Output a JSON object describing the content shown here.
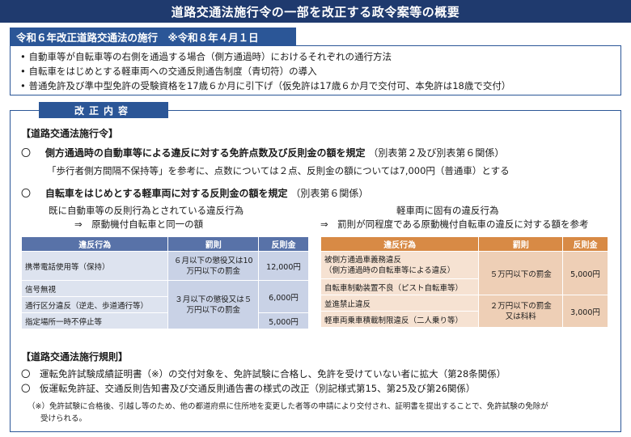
{
  "title": "道路交通法施行令の一部を改正する政令案等の概要",
  "section1": {
    "header": "令和６年改正道路交通法の施行　※令和８年４月１日",
    "bullets": [
      "自動車等が自転車等の右側を通過する場合（側方通過時）におけるそれぞれの通行方法",
      "自転車をはじめとする軽車両への交通反則通告制度（青切符）の導入",
      "普通免許及び準中型免許の受験資格を17歳６か月に引下げ（仮免許は17歳６か月で交付可、本免許は18歳で交付）"
    ]
  },
  "section2": {
    "header": "改正内容",
    "order": {
      "heading": "【道路交通法施行令】",
      "item1": {
        "mark": "〇",
        "bold": "側方通過時の自動車等による違反に対する免許点数及び反則金の額を規定",
        "ref": "（別表第２及び別表第６関係）",
        "detail": "「歩行者側方間隔不保持等」を参考に、点数については２点、反則金の額については7,000円（普通車）とする"
      },
      "item2": {
        "mark": "〇",
        "bold": "自転車をはじめとする軽車両に対する反則金の額を規定",
        "ref": "（別表第６関係）"
      },
      "left_caption1": "既に自動車等の反則行為とされている違反行為",
      "left_caption2": "⇒　原動機付自転車と同一の額",
      "right_caption1": "軽車両に固有の違反行為",
      "right_caption2": "⇒　罰則が同程度である原動機付自転車の違反に対する額を参考",
      "left_table": {
        "headers": [
          "違反行為",
          "罰則",
          "反則金"
        ],
        "r1_act": "携帯電話使用等（保持）",
        "r1_pen": "６月以下の懲役又は10万円以下の罰金",
        "r1_fine": "12,000円",
        "r2_act": "信号無視",
        "r3_act": "通行区分違反（逆走、歩道通行等）",
        "r4_act": "指定場所一時不停止等",
        "r234_pen": "３月以下の懲役又は５万円以下の罰金",
        "r23_fine": "6,000円",
        "r4_fine": "5,000円"
      },
      "right_table": {
        "headers": [
          "違反行為",
          "罰則",
          "反則金"
        ],
        "r1_act_a": "被側方通過車義務違反",
        "r1_act_b": "（側方通過時の自転車等による違反）",
        "r2_act": "自転車制動装置不良（ピスト自転車等）",
        "r12_pen": "５万円以下の罰金",
        "r12_fine": "5,000円",
        "r3_act": "並進禁止違反",
        "r4_act": "軽車両乗車積載制限違反（二人乗り等）",
        "r34_pen_a": "２万円以下の罰金",
        "r34_pen_b": "又は科料",
        "r34_fine": "3,000円"
      }
    },
    "rules": {
      "heading": "【道路交通法施行規則】",
      "items": [
        "〇　運転免許試験成績証明書（※）の交付対象を、免許試験に合格し、免許を受けていない者に拡大（第28条関係）",
        "〇　仮運転免許証、交通反則告知書及び交通反則通告書の様式の改正（別記様式第15、第25及び第26関係）"
      ],
      "note1": "（※）免許試験に合格後、引越し等のため、他の都道府県に住所地を変更した者等の申請により交付され、証明書を提出することで、免許試験の免除が",
      "note2": "受けられる。"
    }
  }
}
